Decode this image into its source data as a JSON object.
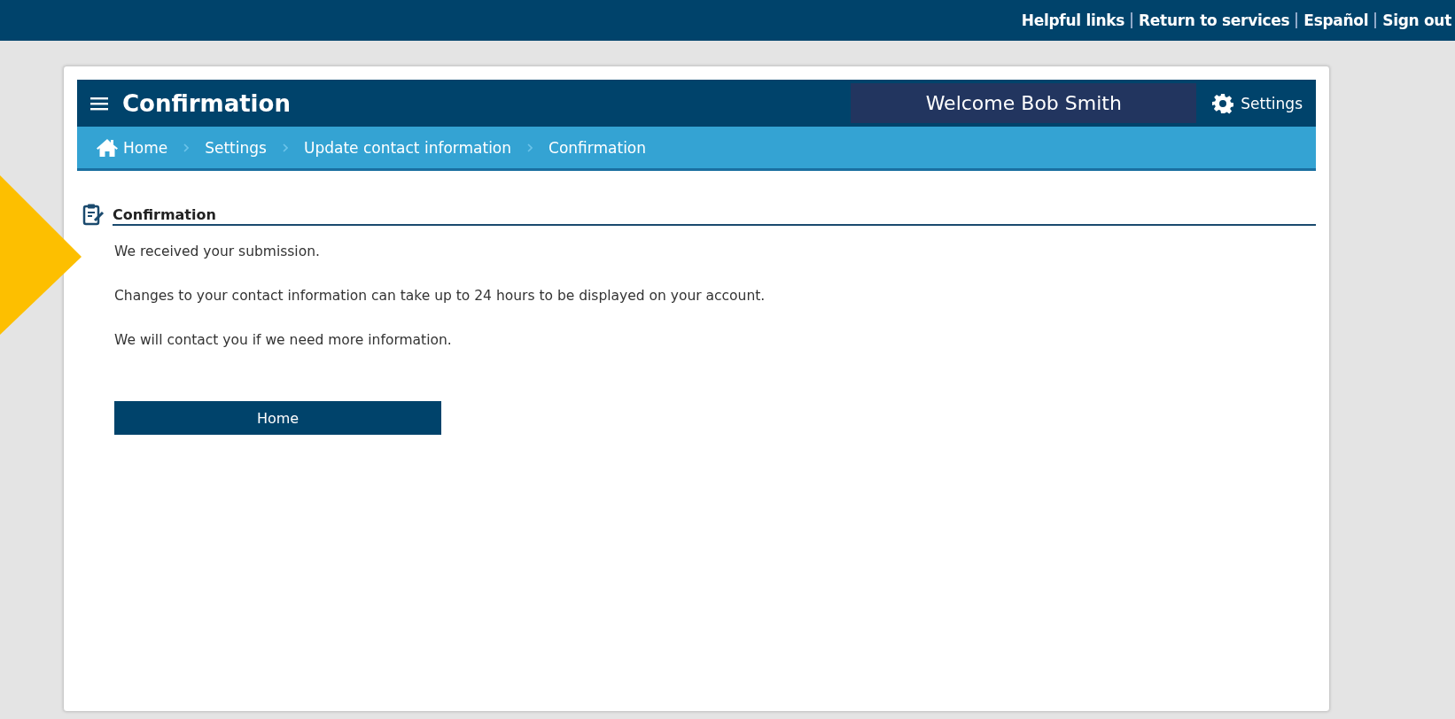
{
  "top_links": [
    "Helpful links",
    "Return to services",
    "Español",
    "Sign out"
  ],
  "header": {
    "title": "Confirmation",
    "welcome": "Welcome Bob Smith",
    "settings": "Settings"
  },
  "breadcrumb": [
    "Home",
    "Settings",
    "Update contact information",
    "Confirmation"
  ],
  "section": {
    "heading": "Confirmation",
    "paragraphs": [
      "We received your submission.",
      "Changes to your contact information can take up to 24 hours to be displayed on your account.",
      "We will contact you if we need more information."
    ]
  },
  "button": "Home"
}
